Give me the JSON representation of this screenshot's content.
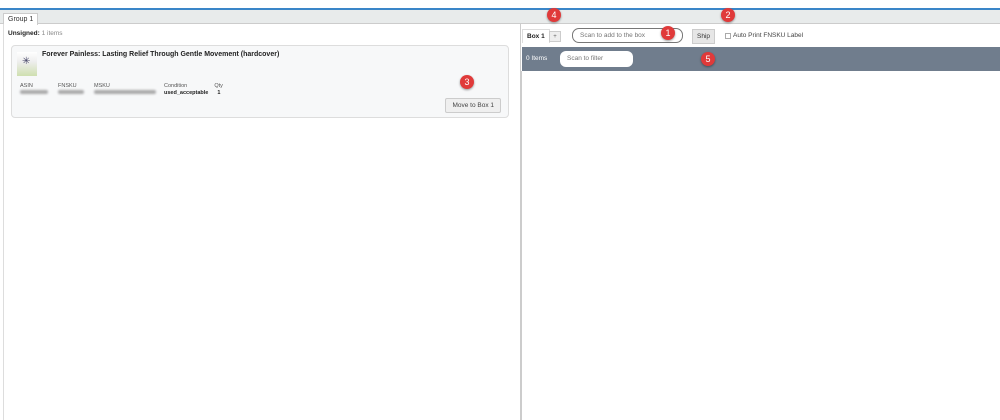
{
  "tabs": [
    {
      "label": "Group 1"
    }
  ],
  "unsigned": {
    "label": "Unsigned:",
    "count": "1 items"
  },
  "item": {
    "title": "Forever Painless: Lasting Relief Through Gentle Movement (hardcover)",
    "fields": {
      "asin_label": "ASIN",
      "fnsku_label": "FNSKU",
      "msku_label": "MSKU",
      "condition_label": "Condition",
      "condition": "used_acceptable",
      "qty_label": "Qty",
      "qty": "1"
    },
    "move_button": "Move to Box 1"
  },
  "box": {
    "tab": "Box 1",
    "add_tab": "+",
    "scan_placeholder": "Scan to add to the box",
    "ship": "Ship",
    "auto_print": "Auto Print FNSKU Label",
    "items_count": "0 Items",
    "filter_placeholder": "Scan to filter"
  },
  "badges": [
    "1",
    "2",
    "3",
    "4",
    "5"
  ]
}
